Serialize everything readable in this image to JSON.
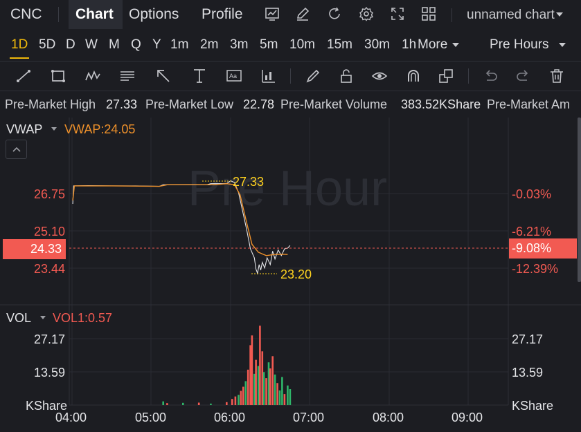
{
  "header": {
    "symbol": "CNC",
    "tabs": [
      {
        "label": "Chart",
        "active": true
      },
      {
        "label": "Options",
        "active": false
      },
      {
        "label": "Profile",
        "active": false
      }
    ],
    "chart_name": "unnamed chart",
    "icons": [
      "chart-icon",
      "edit-icon",
      "refresh-icon",
      "settings-icon",
      "fullscreen-icon",
      "layout-grid-icon",
      "chevron-down-icon"
    ]
  },
  "periods": {
    "items": [
      "1D",
      "5D",
      "D",
      "W",
      "M",
      "Q",
      "Y",
      "1m",
      "2m",
      "3m",
      "5m",
      "10m",
      "15m",
      "30m",
      "1h"
    ],
    "active": "1D",
    "more_label": "More",
    "session_label": "Pre Hours"
  },
  "tools": [
    "trend-line-icon",
    "rectangle-icon",
    "pattern-icon",
    "fibonacci-icon",
    "arrow-icon",
    "measure-icon",
    "text-note-icon",
    "indicator-icon",
    "brush-icon",
    "lock-icon",
    "eye-icon",
    "magnet-icon",
    "layers-icon",
    "undo-icon",
    "redo-icon",
    "trash-icon"
  ],
  "stats": {
    "high_label": "Pre-Market High",
    "high_value": "27.33",
    "low_label": "Pre-Market Low",
    "low_value": "22.78",
    "volume_label": "Pre-Market Volume",
    "volume_value": "383.52KShare",
    "amount_label": "Pre-Market Am"
  },
  "main_panel": {
    "indicator": "VWAP",
    "indicator_value": "VWAP:24.05",
    "watermark": "Pre Hour",
    "left_axis": [
      "26.75",
      "25.10",
      "23.44"
    ],
    "right_axis": [
      "-0.03%",
      "-6.21%",
      "-12.39%"
    ],
    "last_price": "24.33",
    "last_pct": "-9.08%",
    "high_marker": "27.33",
    "low_marker": "23.20"
  },
  "volume_panel": {
    "indicator": "VOL",
    "indicator_value": "VOL1:0.57",
    "axis": [
      "27.17",
      "13.59",
      "KShare"
    ]
  },
  "time_axis": [
    "04:00",
    "05:00",
    "06:00",
    "07:00",
    "08:00",
    "09:00"
  ],
  "colors": {
    "up": "#2fb569",
    "down": "#f25a52",
    "accent": "#f0b90b",
    "vwap": "#f0922b",
    "price": "#e4e5e8",
    "marker": "#ffd21f"
  }
}
